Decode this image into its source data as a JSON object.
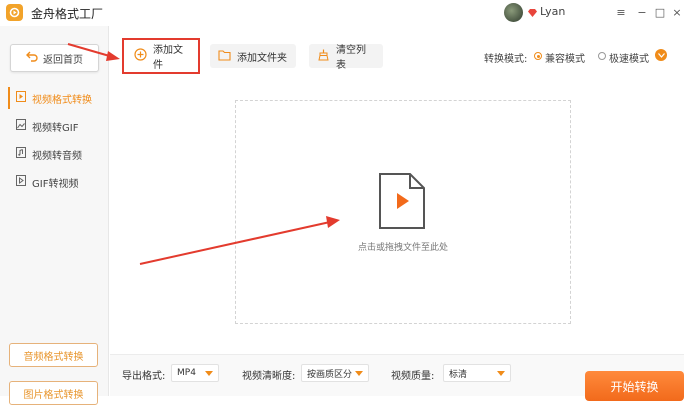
{
  "app": {
    "title": "金舟格式工厂",
    "user_name": "Lyan"
  },
  "window_controls": {
    "menu_icon": "≡",
    "minimize_icon": "−",
    "maximize_icon": "□",
    "close_icon": "×"
  },
  "sidebar": {
    "back_label": "返回首页",
    "items": [
      {
        "label": "视频格式转换",
        "icon": "video-file-icon",
        "active": true
      },
      {
        "label": "视频转GIF",
        "icon": "image-icon",
        "active": false
      },
      {
        "label": "视频转音频",
        "icon": "audio-file-icon",
        "active": false
      },
      {
        "label": "GIF转视频",
        "icon": "gif-file-icon",
        "active": false
      }
    ],
    "bottom_buttons": [
      "音频格式转换",
      "图片格式转换"
    ]
  },
  "toolbar": {
    "add_file_label": "添加文件",
    "add_folder_label": "添加文件夹",
    "clear_list_label": "清空列表",
    "mode_label": "转换模式:",
    "modes": [
      {
        "label": "兼容模式",
        "selected": true
      },
      {
        "label": "极速模式",
        "selected": false
      }
    ]
  },
  "dropzone": {
    "hint": "点击或拖拽文件至此处"
  },
  "bottom": {
    "export_format_label": "导出格式:",
    "export_format_value": "MP4",
    "resolution_label": "视频清晰度:",
    "resolution_value": "按画质区分",
    "quality_label": "视频质量:",
    "quality_value": "标清",
    "start_label": "开始转换"
  },
  "colors": {
    "accent": "#f08c1a",
    "annotation_red": "#e33b2e"
  }
}
